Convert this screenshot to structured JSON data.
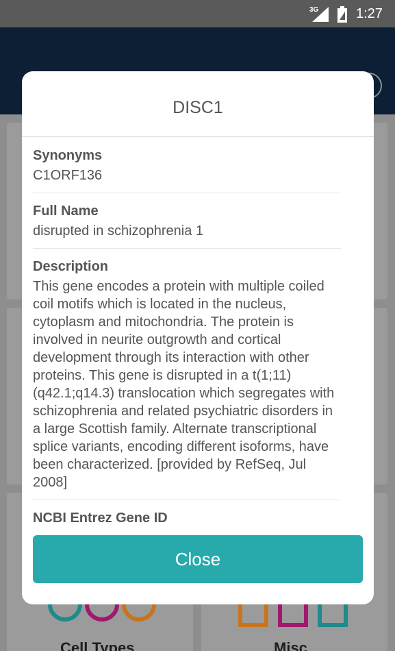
{
  "status_bar": {
    "network": "3G",
    "time": "1:27"
  },
  "modal": {
    "title": "DISC1",
    "sections": [
      {
        "label": "Synonyms",
        "value": "C1ORF136"
      },
      {
        "label": "Full Name",
        "value": "disrupted in schizophrenia 1"
      },
      {
        "label": "Description",
        "value": "This gene encodes a protein with multiple coiled coil motifs which is located in the nucleus, cytoplasm and mitochondria. The protein is involved in neurite outgrowth and cortical development through its interaction with other proteins. This gene is disrupted in a t(1;11)(q42.1;q14.3) translocation which segregates with schizophrenia and related psychiatric disorders in a large Scottish family. Alternate transcriptional splice variants, encoding different isoforms, have been characterized. [provided by RefSeq, Jul 2008]"
      },
      {
        "label": "NCBI Entrez Gene ID",
        "value": ""
      }
    ],
    "close_label": "Close"
  },
  "background_tiles": {
    "cell_types_label": "Cell Types",
    "misc_label": "Misc"
  },
  "colors": {
    "accent": "#28aaad",
    "header": "#0c1f34",
    "ring_teal": "#1f8a8c",
    "ring_magenta": "#a0196e",
    "ring_orange": "#c8741f"
  }
}
